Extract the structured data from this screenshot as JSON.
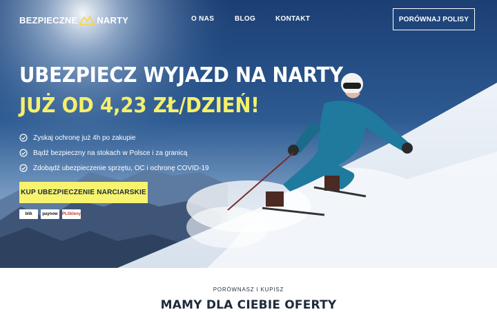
{
  "brand": {
    "logo_left": "BEZPIECZNE",
    "logo_right": "NARTY"
  },
  "nav": [
    {
      "label": "O NAS"
    },
    {
      "label": "BLOG"
    },
    {
      "label": "KONTAKT"
    }
  ],
  "header_cta": "PORÓWNAJ POLISY",
  "hero": {
    "headline": "UBEZPIECZ WYJAZD NA NARTY",
    "price_line": "JUŻ OD 4,23 ZŁ/DZIEŃ!",
    "bullets": [
      "Zyskaj ochronę już 4h po zakupie",
      "Bądź bezpieczny na stokach w Polsce i za granicą",
      "Zdobądź ubezpieczenie sprzętu, OC i ochronę COVID-19"
    ],
    "cta": "KUP UBEZPIECZENIE NARCIARSKIE",
    "payments": [
      "blik",
      "paynow",
      "PLSkleny"
    ]
  },
  "section": {
    "eyebrow": "PORÓWNASZ I KUPISZ",
    "title": "MAMY DLA CIEBIE OFERTY"
  },
  "colors": {
    "accent_yellow": "#f7f36f",
    "headline_yellow": "#f5f06a",
    "dark_text": "#1d2a3a"
  }
}
